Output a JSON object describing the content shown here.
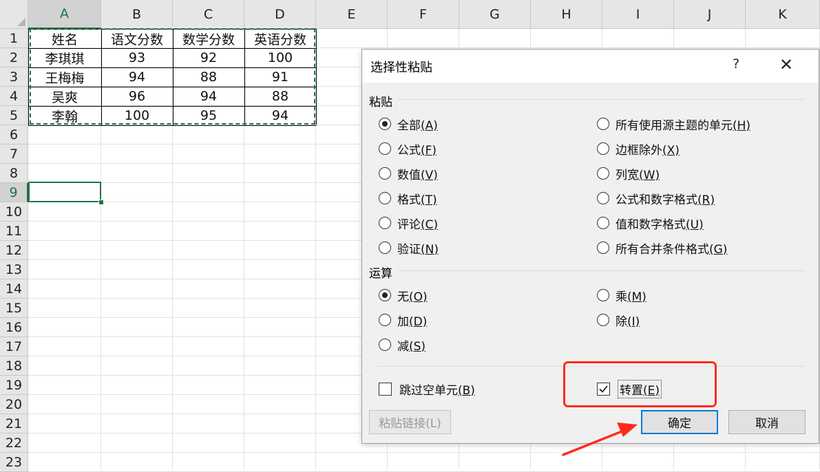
{
  "spreadsheet": {
    "columns": [
      "A",
      "B",
      "C",
      "D",
      "E",
      "F",
      "G",
      "H",
      "I",
      "J",
      "K"
    ],
    "rows": [
      "1",
      "2",
      "3",
      "4",
      "5",
      "6",
      "7",
      "8",
      "9",
      "10",
      "11",
      "12",
      "13",
      "14",
      "15",
      "16",
      "17",
      "18",
      "19",
      "20",
      "21",
      "22",
      "23"
    ],
    "selected_column": "A",
    "selected_row": "9",
    "table": {
      "header": [
        "姓名",
        "语文分数",
        "数学分数",
        "英语分数"
      ],
      "body": [
        [
          "李琪琪",
          "93",
          "92",
          "100"
        ],
        [
          "王梅梅",
          "94",
          "88",
          "91"
        ],
        [
          "吴爽",
          "96",
          "94",
          "88"
        ],
        [
          "李翰",
          "100",
          "95",
          "94"
        ]
      ]
    },
    "accent_color": "#217346"
  },
  "dialog": {
    "title": "选择性粘贴",
    "help": "?",
    "close": "✕",
    "paste_section": "粘贴",
    "paste_options_left": [
      {
        "label": "全部",
        "key": "(A)",
        "checked": true
      },
      {
        "label": "公式",
        "key": "(F)",
        "checked": false
      },
      {
        "label": "数值",
        "key": "(V)",
        "checked": false
      },
      {
        "label": "格式",
        "key": "(T)",
        "checked": false
      },
      {
        "label": "评论",
        "key": "(C)",
        "checked": false
      },
      {
        "label": "验证",
        "key": "(N)",
        "checked": false
      }
    ],
    "paste_options_right": [
      {
        "label": "所有使用源主题的单元",
        "key": "(H)",
        "checked": false
      },
      {
        "label": "边框除外",
        "key": "(X)",
        "checked": false
      },
      {
        "label": "列宽",
        "key": "(W)",
        "checked": false
      },
      {
        "label": "公式和数字格式",
        "key": "(R)",
        "checked": false
      },
      {
        "label": "值和数字格式",
        "key": "(U)",
        "checked": false
      },
      {
        "label": "所有合并条件格式",
        "key": "(G)",
        "checked": false
      }
    ],
    "operation_section": "运算",
    "operation_left": [
      {
        "label": "无",
        "key": "(O)",
        "checked": true
      },
      {
        "label": "加",
        "key": "(D)",
        "checked": false
      },
      {
        "label": "减",
        "key": "(S)",
        "checked": false
      }
    ],
    "operation_right": [
      {
        "label": "乘",
        "key": "(M)",
        "checked": false
      },
      {
        "label": "除",
        "key": "(I)",
        "checked": false
      }
    ],
    "skip_blanks": {
      "label": "跳过空单元",
      "key": "(B)",
      "checked": false
    },
    "transpose": {
      "label": "转置",
      "key": "(E)",
      "checked": true
    },
    "paste_link_button": "粘贴链接(L)",
    "ok_button": "确定",
    "cancel_button": "取消",
    "annotation_color": "#ff2b1a"
  }
}
